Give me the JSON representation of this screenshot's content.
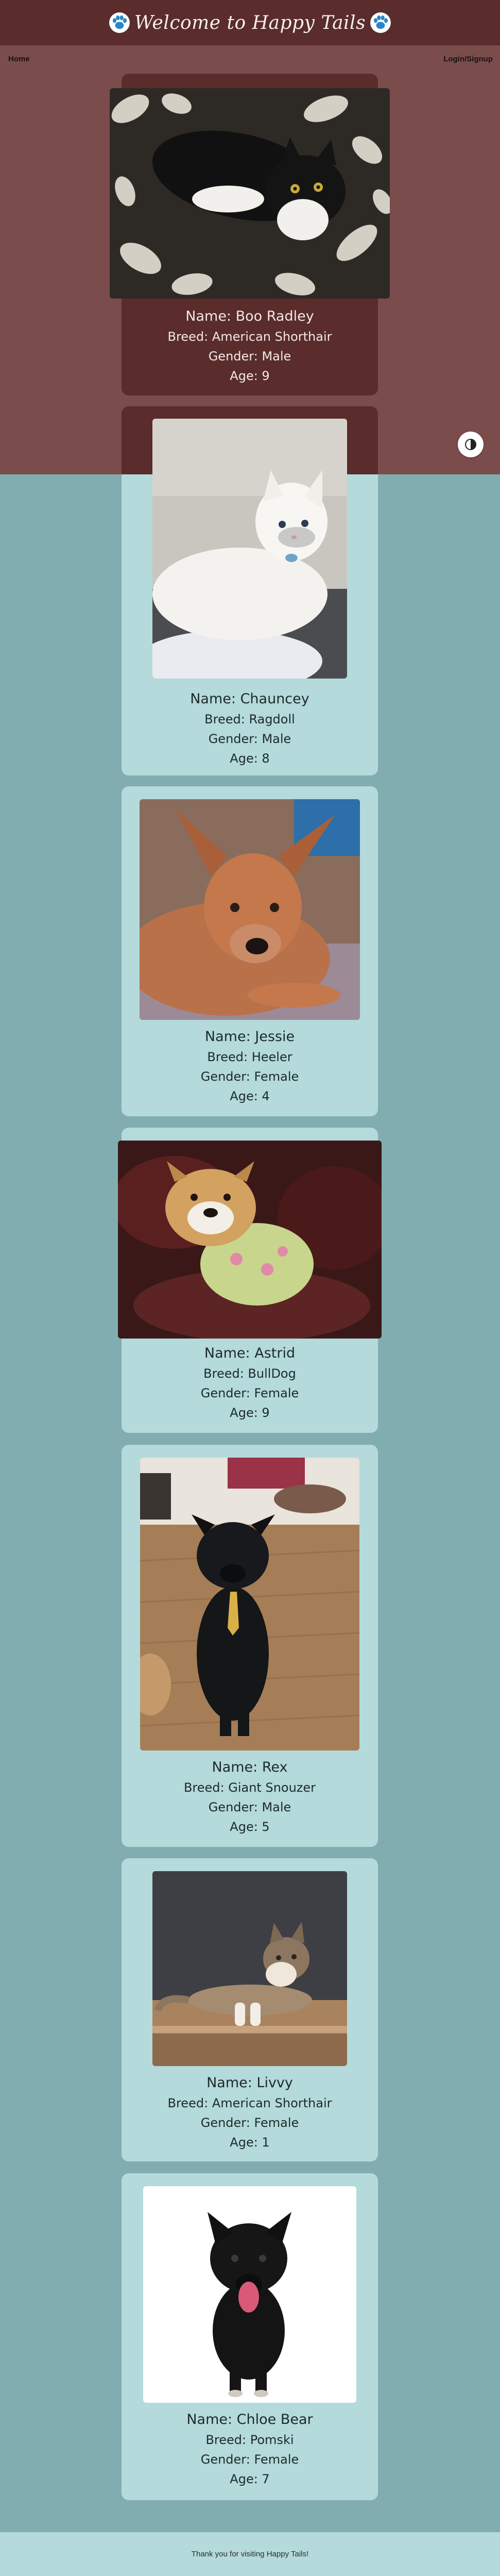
{
  "header": {
    "title": "Welcome to Happy Tails"
  },
  "nav": {
    "home": "Home",
    "login": "Login/Signup"
  },
  "theme_toggle": {
    "icon": "half-moon-icon"
  },
  "labels": {
    "name": "Name:",
    "breed": "Breed:",
    "gender": "Gender:",
    "age": "Age:"
  },
  "pets": [
    {
      "name": "Name: Boo Radley",
      "breed": "Breed: American Shorthair",
      "gender": "Gender: Male",
      "age": "Age: 9",
      "photo": "black-and-white-cat-photo"
    },
    {
      "name": "Name: Chauncey",
      "breed": "Breed: Ragdoll",
      "gender": "Gender: Male",
      "age": "Age: 8",
      "photo": "white-fluffy-cat-photo"
    },
    {
      "name": "Name: Jessie",
      "breed": "Breed: Heeler",
      "gender": "Gender: Female",
      "age": "Age: 4",
      "photo": "red-heeler-dog-photo"
    },
    {
      "name": "Name: Astrid",
      "breed": "Breed: BullDog",
      "gender": "Gender: Female",
      "age": "Age: 9",
      "photo": "bulldog-in-sweater-photo"
    },
    {
      "name": "Name: Rex",
      "breed": "Breed: Giant Snouzer",
      "gender": "Gender: Male",
      "age": "Age: 5",
      "photo": "black-dog-with-tie-photo"
    },
    {
      "name": "Name: Livvy",
      "breed": "Breed: American Shorthair",
      "gender": "Gender: Female",
      "age": "Age: 1",
      "photo": "tabby-cat-on-dresser-photo"
    },
    {
      "name": "Name: Chloe Bear",
      "breed": "Breed: Pomski",
      "gender": "Gender: Female",
      "age": "Age: 7",
      "photo": "black-pomski-dog-photo"
    }
  ],
  "footer": {
    "text": "Thank you for visiting Happy Tails!"
  },
  "colors": {
    "header_bg": "#5a2c2c",
    "top_bg": "#7a4c4c",
    "page_bg": "#82adb0",
    "card_bg": "#b4dadb",
    "card_dark_bg": "#5a2c2c"
  }
}
